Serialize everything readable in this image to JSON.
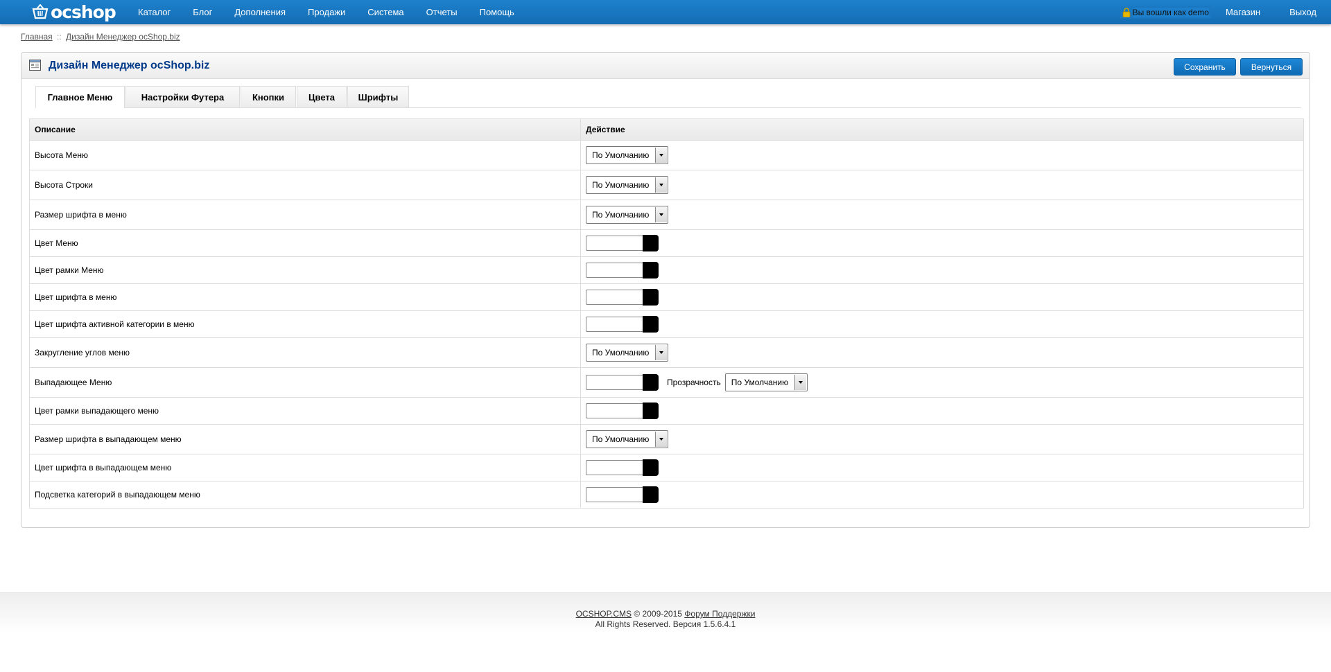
{
  "header": {
    "logo": "ocshop",
    "nav": [
      "Каталог",
      "Блог",
      "Дополнения",
      "Продажи",
      "Система",
      "Отчеты",
      "Помощь"
    ],
    "login_text": "Вы вошли как demo",
    "store_link": "Магазин",
    "logout_link": "Выход"
  },
  "breadcrumb": {
    "home": "Главная",
    "separator": "::",
    "current": "Дизайн Менеджер ocShop.biz"
  },
  "page": {
    "title": "Дизайн Менеджер ocShop.biz",
    "save_label": "Сохранить",
    "back_label": "Вернуться"
  },
  "tabs": [
    "Главное Меню",
    "Настройки Футера",
    "Кнопки",
    "Цвета",
    "Шрифты"
  ],
  "table": {
    "col_description": "Описание",
    "col_action": "Действие",
    "default_option": "По Умолчанию",
    "transparency_label": "Прозрачность",
    "rows": [
      {
        "label": "Высота Меню",
        "control": "select"
      },
      {
        "label": "Высота Строки",
        "control": "select"
      },
      {
        "label": "Размер шрифта в меню",
        "control": "select"
      },
      {
        "label": "Цвет Меню",
        "control": "color"
      },
      {
        "label": "Цвет рамки Меню",
        "control": "color"
      },
      {
        "label": "Цвет шрифта в меню",
        "control": "color"
      },
      {
        "label": "Цвет шрифта активной категории в меню",
        "control": "color"
      },
      {
        "label": "Закругление углов меню",
        "control": "select"
      },
      {
        "label": "Выпадающее Меню",
        "control": "color+transparency"
      },
      {
        "label": "Цвет рамки выпадающего меню",
        "control": "color"
      },
      {
        "label": "Размер шрифта в выпадающем меню",
        "control": "select"
      },
      {
        "label": "Цвет шрифта в выпадающем меню",
        "control": "color"
      },
      {
        "label": "Подсветка категорий в выпадающем меню",
        "control": "color"
      }
    ]
  },
  "footer": {
    "cms_link": "OCSHOP.CMS",
    "copyright": "© 2009-2015",
    "forum_link": "Форум Поддержки",
    "rights": "All Rights Reserved. Версия 1.5.6.4.1"
  },
  "colors": {
    "topbar": "#1a78c2",
    "title": "#003a88",
    "button": "#1578c6",
    "swatch": "#000000"
  }
}
